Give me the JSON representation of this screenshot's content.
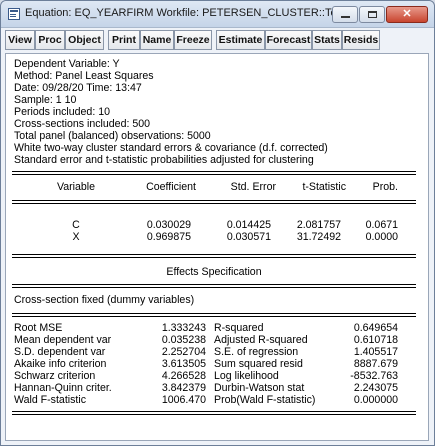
{
  "window": {
    "title": "Equation: EQ_YEARFIRM   Workfile: PETERSEN_CLUSTER::Tes...",
    "close_glyph": "✕"
  },
  "toolbar": {
    "buttons": [
      "View",
      "Proc",
      "Object",
      "Print",
      "Name",
      "Freeze",
      "Estimate",
      "Forecast",
      "Stats",
      "Resids"
    ]
  },
  "header_lines": [
    "Dependent Variable: Y",
    "Method: Panel Least Squares",
    "Date: 09/28/20   Time: 13:47",
    "Sample: 1 10",
    "Periods included: 10",
    "Cross-sections included: 500",
    "Total panel (balanced) observations: 5000",
    "White two-way cluster standard errors & covariance (d.f. corrected)",
    "Standard error and t-statistic probabilities adjusted for clustering"
  ],
  "coef_table": {
    "columns": [
      "Variable",
      "Coefficient",
      "Std. Error",
      "t-Statistic",
      "Prob."
    ],
    "rows": [
      [
        "C",
        "0.030029",
        "0.014425",
        "2.081757",
        "0.0671"
      ],
      [
        "X",
        "0.969875",
        "0.030571",
        "31.72492",
        "0.0000"
      ]
    ]
  },
  "effects": {
    "heading": "Effects Specification",
    "line": "Cross-section fixed (dummy variables)"
  },
  "stats": [
    [
      "Root MSE",
      "1.333243",
      "R-squared",
      "0.649654"
    ],
    [
      "Mean dependent var",
      "0.035238",
      "Adjusted R-squared",
      "0.610718"
    ],
    [
      "S.D. dependent var",
      "2.252704",
      "S.E. of regression",
      "1.405517"
    ],
    [
      "Akaike info criterion",
      "3.613505",
      "Sum squared resid",
      "8887.679"
    ],
    [
      "Schwarz criterion",
      "4.266528",
      "Log likelihood",
      "-8532.763"
    ],
    [
      "Hannan-Quinn criter.",
      "3.842379",
      "Durbin-Watson stat",
      "2.243075"
    ],
    [
      "Wald F-statistic",
      "1006.470",
      "Prob(Wald F-statistic)",
      "0.000000"
    ]
  ]
}
